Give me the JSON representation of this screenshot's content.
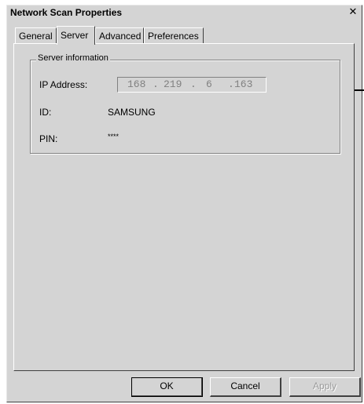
{
  "window": {
    "title": "Network Scan Properties",
    "close_glyph": "✕"
  },
  "tabs": [
    {
      "label": "General",
      "active": false
    },
    {
      "label": "Server",
      "active": true
    },
    {
      "label": "Advanced",
      "active": false
    },
    {
      "label": "Preferences",
      "active": false
    }
  ],
  "server_info": {
    "group_label": "Server information",
    "ip_label": "IP Address:",
    "ip_octets": [
      "168",
      "219",
      "6",
      "163"
    ],
    "ip_separator": ".",
    "id_label": "ID:",
    "id_value": "SAMSUNG",
    "pin_label": "PIN:",
    "pin_value": "****"
  },
  "buttons": {
    "ok": "OK",
    "cancel": "Cancel",
    "apply": "Apply"
  },
  "colors": {
    "dialog_face": "#d4d4d4",
    "disabled_text": "#9a9a9a"
  }
}
